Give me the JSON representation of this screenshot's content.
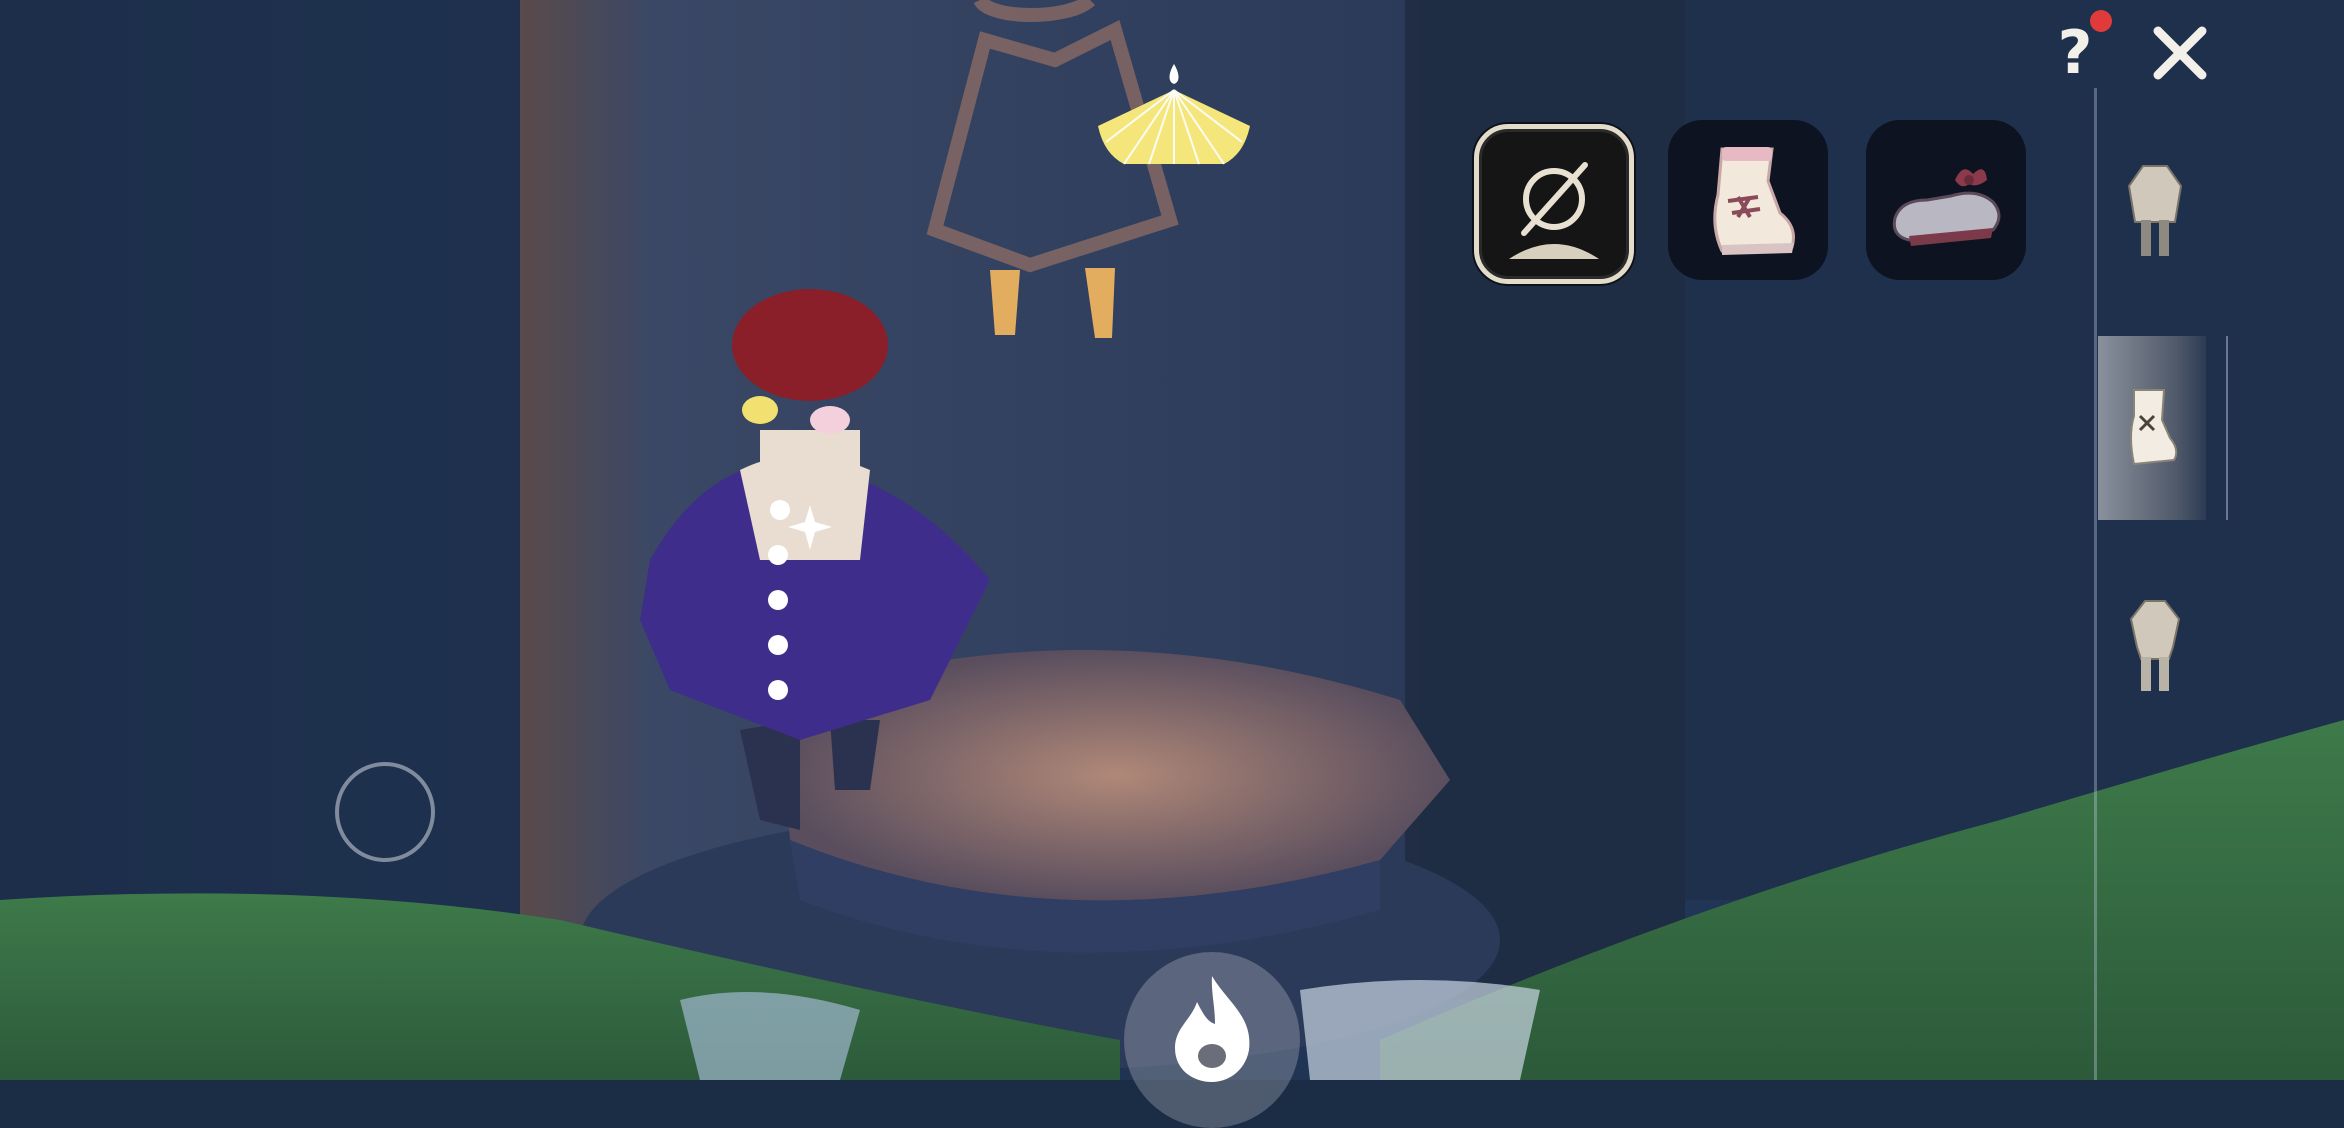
{
  "toolbar": {
    "help_icon": "question-mark-icon",
    "help_label": "?",
    "help_badge_color": "#e03a3a",
    "close_icon": "close-icon"
  },
  "options": [
    {
      "name": "none",
      "icon": "empty-set-icon",
      "selected": true
    },
    {
      "name": "white-boots",
      "icon": "boot-icon",
      "selected": false
    },
    {
      "name": "grey-shoes-with-bow",
      "icon": "shoe-icon",
      "selected": false
    }
  ],
  "categories": [
    {
      "name": "outfit",
      "icon": "outfit-icon",
      "selected": false
    },
    {
      "name": "shoes",
      "icon": "boot-icon",
      "selected": true
    },
    {
      "name": "full-outfit",
      "icon": "body-outfit-icon",
      "selected": false
    }
  ],
  "controls": {
    "joystick_icon": "joystick-ring-icon",
    "honk_icon": "flame-icon",
    "wing_indicator_icon": "fan-icon"
  },
  "colors": {
    "accent_red": "#e03a3a",
    "wing_yellow": "#f4e67a",
    "selected_border": "#e3dccb"
  }
}
